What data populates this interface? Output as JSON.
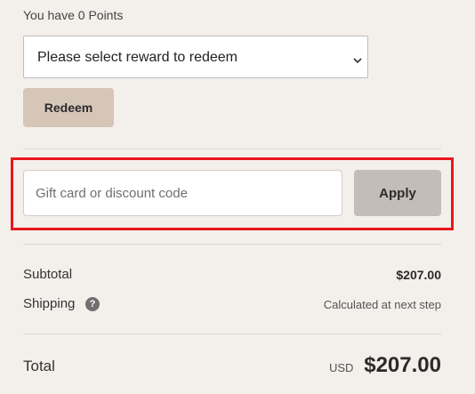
{
  "loyalty": {
    "points_text": "You have 0 Points",
    "reward_select_value": "Please select reward to redeem",
    "redeem_label": "Redeem"
  },
  "discount": {
    "placeholder": "Gift card or discount code",
    "apply_label": "Apply"
  },
  "summary": {
    "subtotal_label": "Subtotal",
    "subtotal_value": "$207.00",
    "shipping_label": "Shipping",
    "shipping_help_glyph": "?",
    "shipping_value": "Calculated at next step",
    "total_label": "Total",
    "total_currency": "USD",
    "total_value": "$207.00"
  },
  "colors": {
    "background": "#f3efeb",
    "redeem_button": "#d6c6b8",
    "apply_button": "#c4bdb7",
    "highlight_border": "#e8171c"
  },
  "icons": {
    "select_chevron": "chevron-down-icon",
    "shipping_help": "question-circle-icon"
  }
}
